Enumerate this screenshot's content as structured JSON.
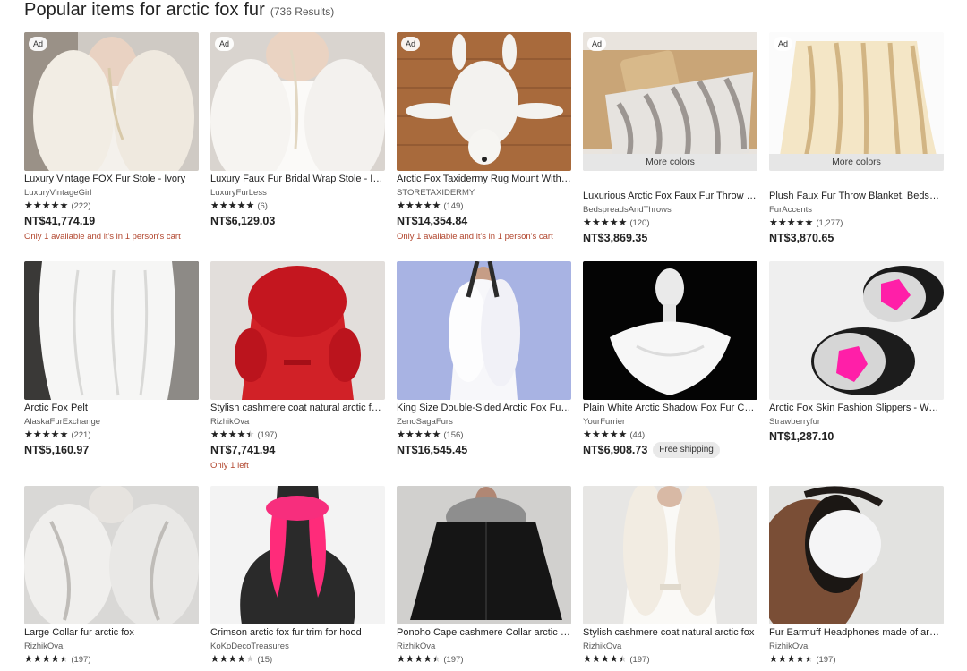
{
  "header": {
    "title": "Popular items for arctic fox fur",
    "count": "(736 Results)"
  },
  "ad_label": "Ad",
  "more_colors_label": "More colors",
  "star_glyphs": "★★★★★",
  "items": [
    {
      "title": "Luxury Vintage FOX Fur Stole - Ivory",
      "shop": "LuxuryVintageGirl",
      "rating": 5,
      "reviews": "(222)",
      "price": "NT$41,774.19",
      "note": "Only 1 available and it's in 1 person's cart",
      "ad": true,
      "more_colors": false,
      "shipping": "",
      "image": "stole-vintage"
    },
    {
      "title": "Luxury Faux Fur Bridal Wrap Stole - Ivory",
      "shop": "LuxuryFurLess",
      "rating": 5,
      "reviews": "(6)",
      "price": "NT$6,129.03",
      "note": "",
      "ad": true,
      "more_colors": false,
      "shipping": "",
      "image": "bridal-wrap"
    },
    {
      "title": "Arctic Fox Taxidermy Rug Mount With Head",
      "shop": "STORETAXIDERMY",
      "rating": 5,
      "reviews": "(149)",
      "price": "NT$14,354.84",
      "note": "Only 1 available and it's in 1 person's cart",
      "ad": true,
      "more_colors": false,
      "shipping": "",
      "image": "fox-rug"
    },
    {
      "title": "Luxurious Arctic Fox Faux Fur Throw Blanket",
      "shop": "BedspreadsAndThrows",
      "rating": 5,
      "reviews": "(120)",
      "price": "NT$3,869.35",
      "note": "",
      "ad": true,
      "more_colors": true,
      "shipping": "",
      "image": "throw-sofa"
    },
    {
      "title": "Plush Faux Fur Throw Blanket, Bedspread",
      "shop": "FurAccents",
      "rating": 5,
      "reviews": "(1,277)",
      "price": "NT$3,870.65",
      "note": "",
      "ad": true,
      "more_colors": true,
      "shipping": "",
      "image": "throw-hanging"
    },
    {
      "title": "Arctic Fox Pelt",
      "shop": "AlaskaFurExchange",
      "rating": 5,
      "reviews": "(221)",
      "price": "NT$5,160.97",
      "note": "",
      "ad": false,
      "more_colors": false,
      "shipping": "",
      "image": "fox-pelt"
    },
    {
      "title": "Stylish cashmere coat natural arctic fox fur",
      "shop": "RizhikOva",
      "rating": 4.5,
      "reviews": "(197)",
      "price": "NT$7,741.94",
      "note": "Only 1 left",
      "ad": false,
      "more_colors": false,
      "shipping": "",
      "image": "red-coat"
    },
    {
      "title": "King Size Double-Sided Arctic Fox Fur Stole",
      "shop": "ZenoSagaFurs",
      "rating": 5,
      "reviews": "(156)",
      "price": "NT$16,545.45",
      "note": "",
      "ad": false,
      "more_colors": false,
      "shipping": "",
      "image": "white-stole-blue"
    },
    {
      "title": "Plain White Arctic Shadow Fox Fur Cape",
      "shop": "YourFurrier",
      "rating": 5,
      "reviews": "(44)",
      "price": "NT$6,908.73",
      "note": "",
      "ad": false,
      "more_colors": false,
      "shipping": "Free shipping",
      "image": "mannequin-cape"
    },
    {
      "title": "Arctic Fox Skin Fashion Slippers - Women",
      "shop": "Strawberryfur",
      "rating": null,
      "reviews": "",
      "price": "NT$1,287.10",
      "note": "",
      "ad": false,
      "more_colors": false,
      "shipping": "",
      "image": "slippers"
    },
    {
      "title": "Large Collar fur arctic fox",
      "shop": "RizhikOva",
      "rating": 4.5,
      "reviews": "(197)",
      "price": "",
      "note": "",
      "ad": false,
      "more_colors": false,
      "shipping": "",
      "image": "collar-grey"
    },
    {
      "title": "Crimson arctic fox fur trim for hood",
      "shop": "KoKoDecoTreasures",
      "rating": 4,
      "reviews": "(15)",
      "price": "",
      "note": "",
      "ad": false,
      "more_colors": false,
      "shipping": "",
      "image": "pink-trim"
    },
    {
      "title": "Ponoho Cape cashmere Collar arctic fox",
      "shop": "RizhikOva",
      "rating": 4.5,
      "reviews": "(197)",
      "price": "",
      "note": "",
      "ad": false,
      "more_colors": false,
      "shipping": "",
      "image": "black-cape"
    },
    {
      "title": "Stylish cashmere coat natural arctic fox",
      "shop": "RizhikOva",
      "rating": 4.5,
      "reviews": "(197)",
      "price": "",
      "note": "",
      "ad": false,
      "more_colors": false,
      "shipping": "",
      "image": "white-coat"
    },
    {
      "title": "Fur Earmuff Headphones made of arctic fox",
      "shop": "RizhikOva",
      "rating": 4.5,
      "reviews": "(197)",
      "price": "",
      "note": "",
      "ad": false,
      "more_colors": false,
      "shipping": "",
      "image": "earmuff"
    }
  ]
}
